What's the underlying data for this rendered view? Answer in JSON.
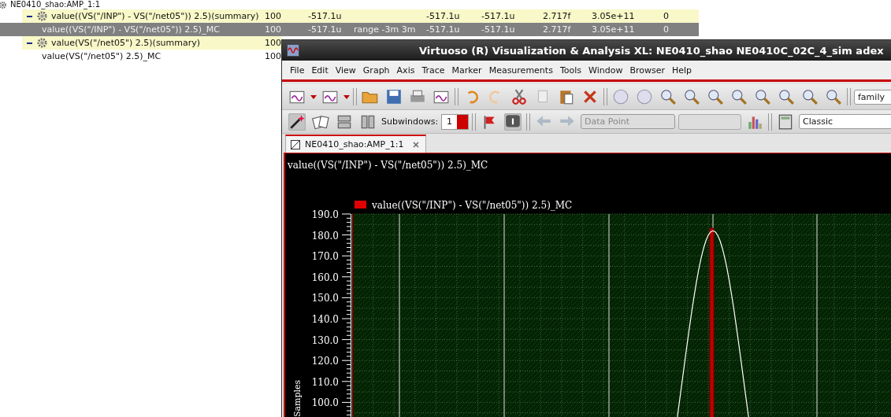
{
  "tree": {
    "root": {
      "label": "NE0410_shao:AMP_1:1"
    },
    "rows": [
      {
        "label": "value((VS(\"/INP\") - VS(\"/net05\")) 2.5)(summary)",
        "expanded": true,
        "selected": false,
        "column_1": "100",
        "column_2": "-517.1u",
        "column_4": "-517.1u",
        "column_5": "-517.1u",
        "column_6": "2.717f",
        "column_7": "3.05e+11",
        "column_8": "0",
        "children": [
          {
            "label": "value((VS(\"/INP\") - VS(\"/net05\")) 2.5)_MC",
            "selected": true,
            "column_1": "100",
            "column_2": "-517.1u",
            "column_3": "range -3m 3m",
            "column_4": "-517.1u",
            "column_5": "-517.1u",
            "column_6": "2.717f",
            "column_7": "3.05e+11",
            "column_8": "0"
          }
        ]
      },
      {
        "label": "value(VS(\"/net05\") 2.5)(summary)",
        "expanded": true,
        "selected": false,
        "column_1": "100",
        "children": [
          {
            "label": "value(VS(\"/net05\") 2.5)_MC",
            "selected": false,
            "column_1": "100"
          }
        ]
      }
    ]
  },
  "window": {
    "title": "Virtuoso (R) Visualization & Analysis XL: NE0410_shao NE0410C_02C_4_sim adex",
    "menu": [
      "File",
      "Edit",
      "View",
      "Graph",
      "Axis",
      "Trace",
      "Marker",
      "Measurements",
      "Tools",
      "Window",
      "Browser",
      "Help"
    ],
    "toolbar": {
      "family_field": "family",
      "subwindows_label": "Subwindows:",
      "subwindows_value": "1",
      "data_point": {
        "value": "Data Point",
        "disabled": true
      },
      "mode_field": "Classic"
    },
    "tabs": [
      {
        "label": "NE0410_shao:AMP_1:1",
        "selected": true
      }
    ],
    "plot": {
      "title": "value((VS(\"/INP\") - VS(\"/net05\")) 2.5)_MC",
      "legend": {
        "label": "value((VS(\"/INP\") - VS(\"/net05\")) 2.5)_MC",
        "color": "#e00000"
      },
      "y_axis_title": "Samples",
      "y_tick_labels": [
        "190.0",
        "180.0",
        "170.0",
        "160.0",
        "150.0",
        "140.0",
        "130.0",
        "120.0",
        "110.0",
        "100.0"
      ]
    }
  }
}
